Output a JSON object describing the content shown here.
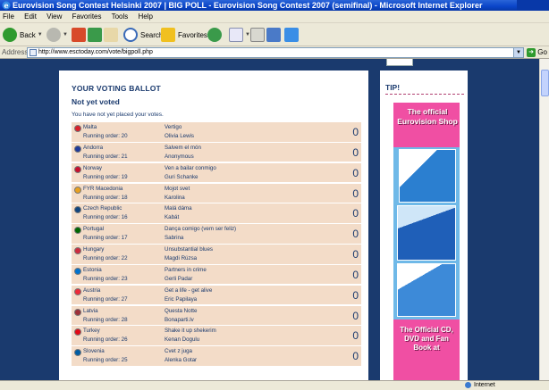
{
  "window": {
    "title": "Eurovision Song Contest Helsinki 2007 | BIG POLL - Eurovision Song Contest 2007 (semifinal) - Microsoft Internet Explorer"
  },
  "menu": [
    "File",
    "Edit",
    "View",
    "Favorites",
    "Tools",
    "Help"
  ],
  "toolbar": {
    "back_label": "Back",
    "search_label": "Search",
    "favorites_label": "Favorites"
  },
  "address": {
    "label": "Address",
    "url": "http://www.esctoday.com/vote/bigpoll.php",
    "go_label": "Go"
  },
  "ballot": {
    "title": "YOUR VOTING BALLOT",
    "subtitle": "Not yet voted",
    "note": "You have not yet placed your votes.",
    "entries": [
      {
        "country": "Malta",
        "order": "Running order: 20",
        "song": "Vertigo",
        "artist": "Olivia Lewis",
        "votes": "0"
      },
      {
        "country": "Andorra",
        "order": "Running order: 21",
        "song": "Salvem el món",
        "artist": "Anonymous",
        "votes": "0"
      },
      {
        "country": "Norway",
        "order": "Running order: 19",
        "song": "Ven a bailar conmigo",
        "artist": "Guri Schanke",
        "votes": "0"
      },
      {
        "country": "FYR Macedonia",
        "order": "Running order: 18",
        "song": "Mojot svet",
        "artist": "Karolina",
        "votes": "0"
      },
      {
        "country": "Czech Republic",
        "order": "Running order: 16",
        "song": "Malá dáma",
        "artist": "Kabát",
        "votes": "0"
      },
      {
        "country": "Portugal",
        "order": "Running order: 17",
        "song": "Dança comigo (vem ser feliz)",
        "artist": "Sabrina",
        "votes": "0"
      },
      {
        "country": "Hungary",
        "order": "Running order: 22",
        "song": "Unsubstantial blues",
        "artist": "Magdi Rúzsa",
        "votes": "0"
      },
      {
        "country": "Estonia",
        "order": "Running order: 23",
        "song": "Partners in crime",
        "artist": "Gerli Padar",
        "votes": "0"
      },
      {
        "country": "Austria",
        "order": "Running order: 27",
        "song": "Get a life - get alive",
        "artist": "Eric Papilaya",
        "votes": "0"
      },
      {
        "country": "Latvia",
        "order": "Running order: 28",
        "song": "Questa Notte",
        "artist": "Bonaparti.lv",
        "votes": "0"
      },
      {
        "country": "Turkey",
        "order": "Running order: 26",
        "song": "Shake it up shekerim",
        "artist": "Kenan Dogulu",
        "votes": "0"
      },
      {
        "country": "Slovenia",
        "order": "Running order: 25",
        "song": "Cvet z juga",
        "artist": "Alenka Gotar",
        "votes": "0"
      }
    ]
  },
  "sidebar": {
    "tip_label": "TIP!",
    "banner_top": "The official Eurovision Shop",
    "banner_bottom": "The Official CD, DVD and Fan Book at"
  },
  "status": {
    "zone": "Internet"
  },
  "colors": {
    "page_background": "#1a3a6e",
    "row_background": "#f3dcc8",
    "banner_pink": "#f04fa3",
    "banner_blue": "#6fb9e8"
  },
  "flag_colors": [
    "#d8202a",
    "#1f3a9a",
    "#c8102e",
    "#e8a020",
    "#11457e",
    "#006600",
    "#cd2a3e",
    "#0072ce",
    "#ed2939",
    "#9e3039",
    "#e30a17",
    "#005da4"
  ]
}
